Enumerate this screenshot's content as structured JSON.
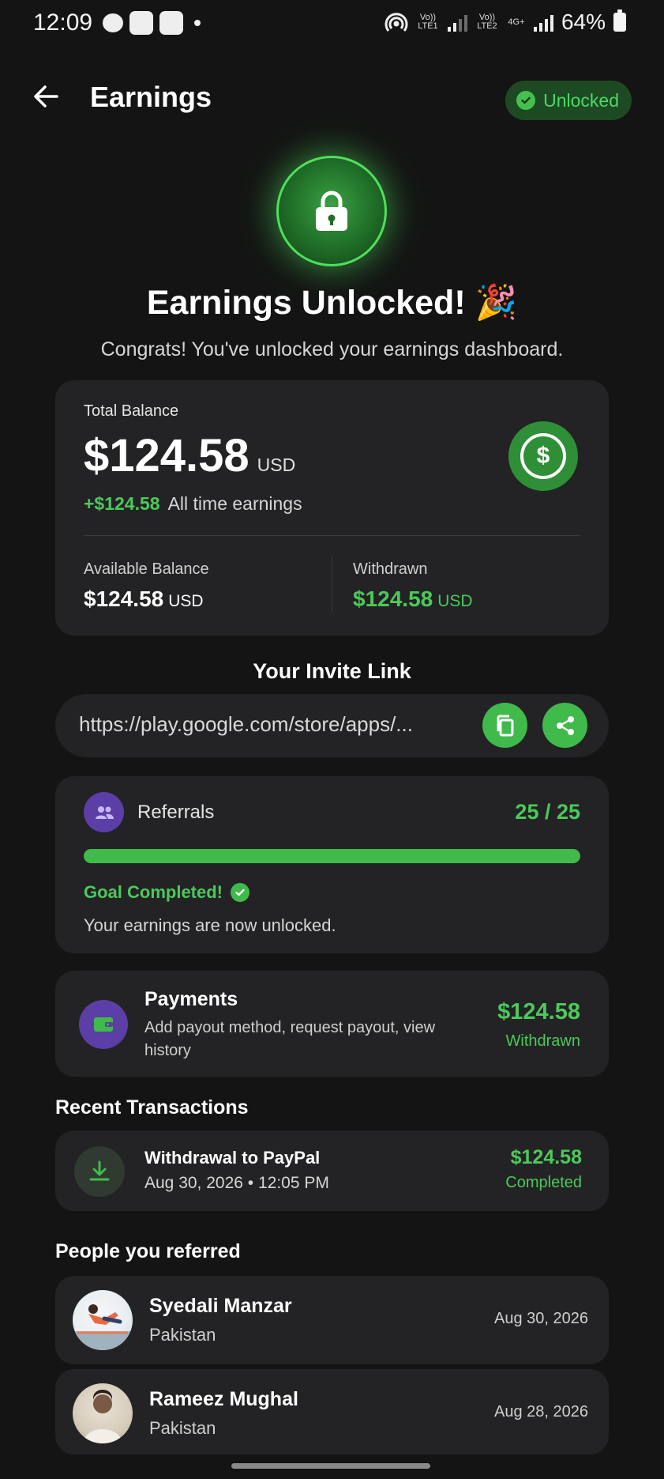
{
  "status_bar": {
    "time": "12:09",
    "network1": "Vo)) LTE1",
    "network2": "Vo)) LTE2",
    "network_type": "4G+",
    "battery": "64%"
  },
  "header": {
    "title": "Earnings",
    "badge": "Unlocked"
  },
  "hero": {
    "title": "Earnings Unlocked! 🎉",
    "subtitle": "Congrats! You've unlocked your earnings dashboard."
  },
  "balance": {
    "label": "Total Balance",
    "amount": "$124.58",
    "currency": "USD",
    "delta": "+$124.58",
    "delta_label": "All time earnings",
    "available_label": "Available Balance",
    "available_amount": "$124.58",
    "available_currency": "USD",
    "withdrawn_label": "Withdrawn",
    "withdrawn_amount": "$124.58",
    "withdrawn_currency": "USD"
  },
  "invite": {
    "title": "Your Invite Link",
    "url": "https://play.google.com/store/apps/..."
  },
  "referrals": {
    "label": "Referrals",
    "count": "25 / 25",
    "progress": 1.0,
    "goal_text": "Goal Completed!",
    "note": "Your earnings are now unlocked."
  },
  "payments": {
    "title": "Payments",
    "description": "Add payout method, request payout, view history",
    "amount": "$124.58",
    "status": "Withdrawn"
  },
  "transactions": {
    "title": "Recent Transactions",
    "items": [
      {
        "title": "Withdrawal to PayPal",
        "date": "Aug 30, 2026 • 12:05 PM",
        "amount": "$124.58",
        "status": "Completed"
      }
    ]
  },
  "referred": {
    "title": "People you referred",
    "people": [
      {
        "name": "Syedali Manzar",
        "country": "Pakistan",
        "date": "Aug 30, 2026"
      },
      {
        "name": "Rameez Mughal",
        "country": "Pakistan",
        "date": "Aug 28, 2026"
      }
    ]
  },
  "colors": {
    "background": "#141414",
    "card": "#232325",
    "accent_green": "#4cc95a",
    "purple": "#5b3ea6"
  }
}
